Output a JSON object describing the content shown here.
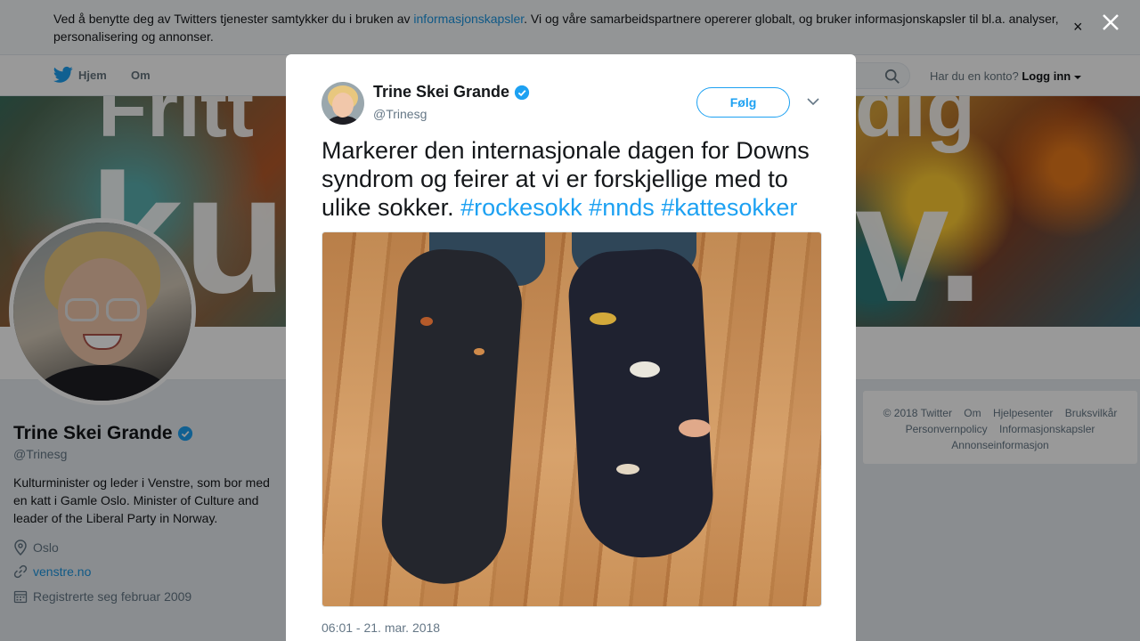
{
  "cookie": {
    "text_before": "Ved å benytte deg av Twitters tjenester samtykker du i bruken av ",
    "link": "informasjonskapsler",
    "text_after": ". Vi og våre samarbeidspartnere opererer globalt, og bruker informasjonskapsler til bl.a. analyser, personalisering og annonser.",
    "close": "×"
  },
  "nav": {
    "home": "Hjem",
    "about": "Om",
    "account_prompt": "Har du en konto?",
    "login": "Logg inn"
  },
  "banner": {
    "words": [
      "Fritt",
      "dig",
      "ku",
      "v."
    ]
  },
  "profile": {
    "name": "Trine Skei Grande",
    "handle": "@Trinesg",
    "bio": "Kulturminister og leder i Venstre, som bor med en katt i Gamle Oslo. Minister of Culture and leader of the Liberal Party in Norway.",
    "location": "Oslo",
    "website": "venstre.no",
    "joined": "Registrerte seg februar 2009"
  },
  "footer": {
    "links": [
      "© 2018 Twitter",
      "Om",
      "Hjelpesenter",
      "Bruksvilkår",
      "Personvernpolicy",
      "Informasjonskapsler",
      "Annonseinformasjon"
    ]
  },
  "tweet": {
    "name": "Trine Skei Grande",
    "handle": "@Trinesg",
    "follow": "Følg",
    "text": "Markerer den internasjonale dagen for Downs syndrom og feirer at vi er forskjellige med to ulike sokker.",
    "hashtags": [
      "#rockesokk",
      "#nnds",
      "#kattesokker"
    ],
    "timestamp": "06:01 - 21. mar. 2018"
  },
  "colors": {
    "accent": "#1da1f2",
    "link": "#1b95e0",
    "overlay": "rgba(0,0,0,0.40)"
  },
  "icons": [
    "twitter-bird-icon",
    "search-icon",
    "caret-down-icon",
    "verified-badge-icon",
    "location-icon",
    "link-icon",
    "calendar-icon",
    "close-icon",
    "chevron-down-icon"
  ]
}
